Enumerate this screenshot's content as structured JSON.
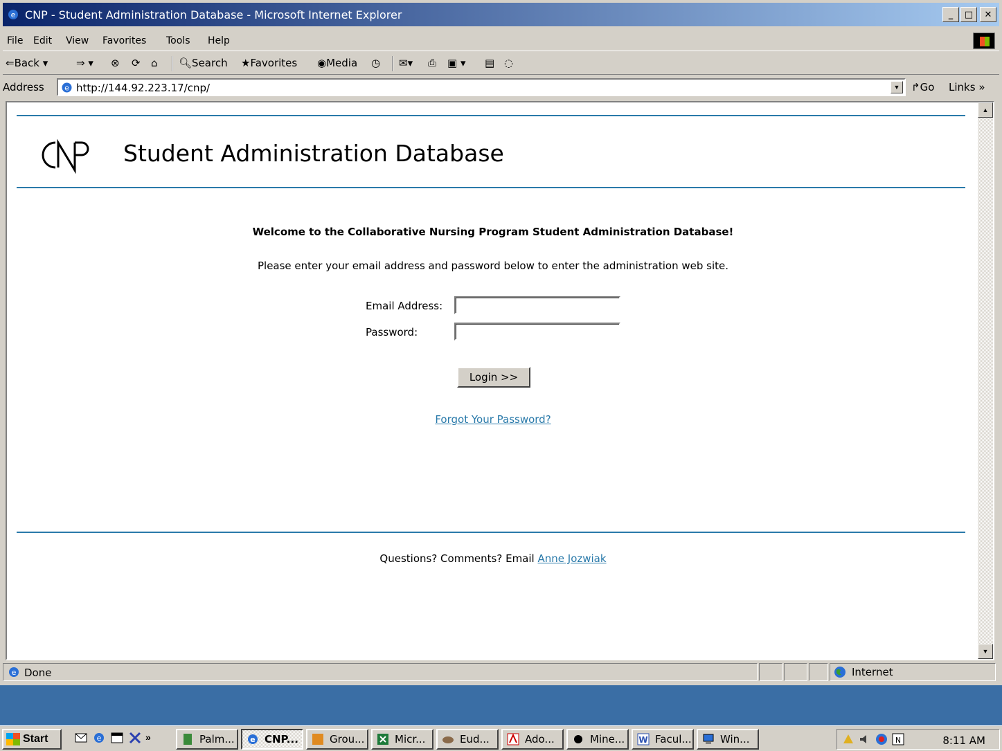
{
  "window": {
    "title": "CNP - Student Administration Database - Microsoft Internet Explorer",
    "buttons": {
      "minimize": "_",
      "maximize": "□",
      "close": "✕"
    }
  },
  "menubar": {
    "items": [
      "File",
      "Edit",
      "View",
      "Favorites",
      "Tools",
      "Help"
    ]
  },
  "toolbar": {
    "back": "Back",
    "search": "Search",
    "favorites": "Favorites",
    "media": "Media"
  },
  "addressbar": {
    "label": "Address",
    "url": "http://144.92.223.17/cnp/",
    "go": "Go",
    "links": "Links"
  },
  "page": {
    "logo_text": "CNP",
    "title": "Student Administration Database",
    "welcome": "Welcome to the Collaborative Nursing Program Student Administration Database!",
    "instructions": "Please enter your email address and password below to enter the administration web site.",
    "email_label": "Email Address:",
    "email_value": "",
    "password_label": "Password:",
    "password_value": "",
    "login_button": "Login >>",
    "forgot_link": "Forgot Your Password?",
    "footer_text": "Questions? Comments? Email",
    "footer_link": "Anne Jozwiak",
    "accent_color": "#2a7aaa"
  },
  "statusbar": {
    "status": "Done",
    "zone": "Internet"
  },
  "taskbar": {
    "start": "Start",
    "tasks": [
      "Palm...",
      "CNP...",
      "Grou...",
      "Micr...",
      "Eud...",
      "Ado...",
      "Mine...",
      "Facul...",
      "Win..."
    ],
    "active_task": "CNP...",
    "clock": "8:11 AM"
  }
}
